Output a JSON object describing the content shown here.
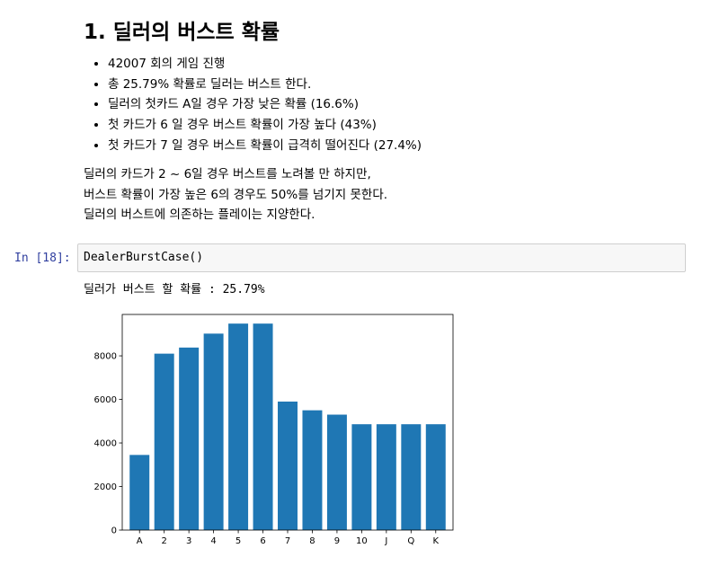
{
  "markdown": {
    "title": "1. 딜러의 버스트 확률",
    "bullets": [
      "42007 회의 게임 진행",
      "총 25.79% 확률로 딜러는 버스트 한다.",
      "딜러의 첫카드 A일 경우 가장 낮은 확률 (16.6%)",
      "첫 카드가 6 일 경우 버스트 확률이 가장 높다 (43%)",
      "첫 카드가 7 일 경우 버스트 확률이 급격히 떨어진다 (27.4%)"
    ],
    "paragraph": [
      "딜러의 카드가 2 ~ 6일 경우 버스트를 노려볼 만 하지만,",
      "버스트 확률이 가장 높은 6의 경우도 50%를 넘기지 못한다.",
      "딜러의 버스트에 의존하는 플레이는 지양한다."
    ]
  },
  "cell": {
    "prompt": "In [18]:",
    "code": "DealerBurstCase()",
    "output": "딜러가 버스트 할 확률 : 25.79%"
  },
  "chart_data": {
    "type": "bar",
    "categories": [
      "A",
      "2",
      "3",
      "4",
      "5",
      "6",
      "7",
      "8",
      "9",
      "10",
      "J",
      "Q",
      "K"
    ],
    "values": [
      3450,
      8100,
      8380,
      9020,
      9480,
      9480,
      5900,
      5500,
      5300,
      4860,
      4860,
      4860,
      4860
    ],
    "ylim": [
      0,
      9900
    ],
    "yticks": [
      0,
      2000,
      4000,
      6000,
      8000
    ],
    "bar_color": "#1f77b4",
    "grid": false
  }
}
